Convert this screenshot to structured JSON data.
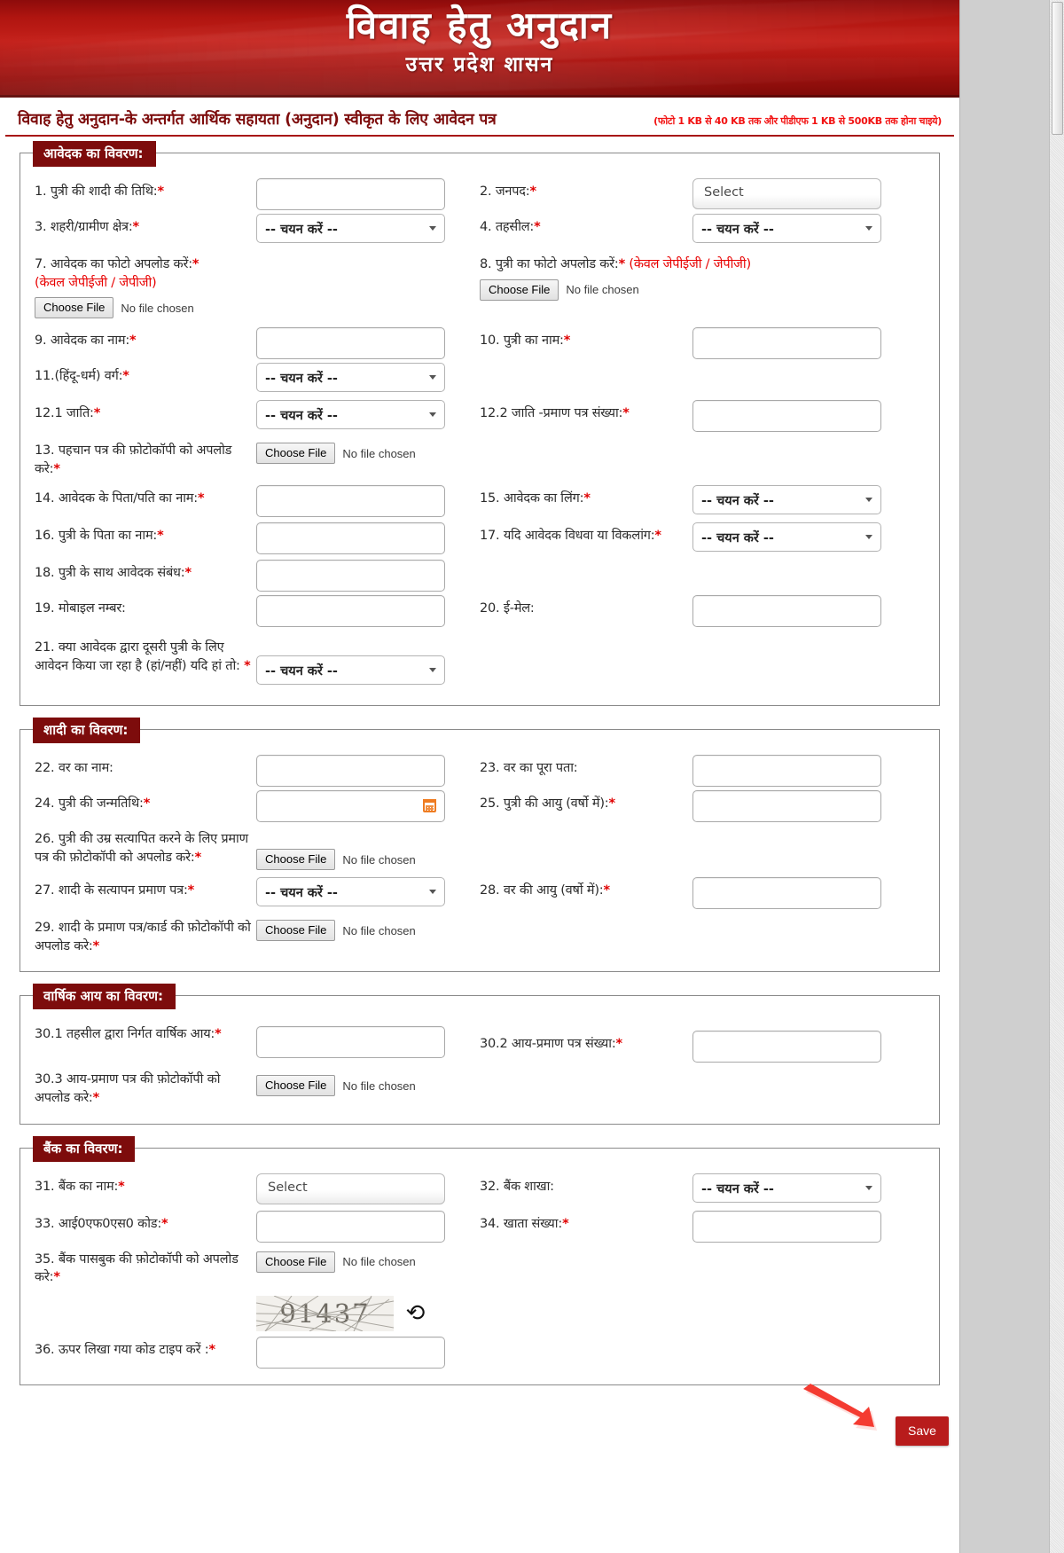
{
  "banner": {
    "title": "विवाह हेतु अनुदान",
    "subtitle": "उत्तर प्रदेश शासन"
  },
  "form": {
    "title": "विवाह हेतु अनुदान-के अन्तर्गत आर्थिक सहायता (अनुदान) स्वीकृत के लिए आवेदन पत्र",
    "note": "(फोटो 1 KB से 40 KB तक और पीडीएफ 1 KB से 500KB तक होना चाइये)"
  },
  "common": {
    "select_placeholder": "-- चयन करें --",
    "select_plain": "Select",
    "choose_file": "Choose File",
    "no_file": "No file chosen"
  },
  "sections": {
    "applicant": {
      "legend": "आवेदक का विवरण:",
      "f1_label": "1. पुत्री की शादी की तिथि:",
      "f2_label": "2. जनपद:",
      "f2_value": "Select",
      "f3_label": "3. शहरी/ग्रामीण क्षेत्र:",
      "f3_value": "-- चयन करें --",
      "f4_label": "4. तहसील:",
      "f4_value": "-- चयन करें --",
      "f7_label": "7. आवेदक का फोटो अपलोड करें:",
      "f7_note": "(केवल जेपीईजी / जेपीजी)",
      "f8_label": "8. पुत्री का फोटो अपलोड करें:",
      "f8_note": "(केवल जेपीईजी / जेपीजी)",
      "f9_label": "9. आवेदक का नाम:",
      "f10_label": "10. पुत्री का नाम:",
      "f11_label": "11.(हिंदू-धर्म) वर्ग:",
      "f11_value": "-- चयन करें --",
      "f121_label": "12.1 जाति:",
      "f121_value": "-- चयन करें --",
      "f122_label": "12.2 जाति -प्रमाण पत्र संख्या:",
      "f13_label": "13. पहचान पत्र की फ़ोटोकॉपी को अपलोड करे:",
      "f14_label": "14. आवेदक के पिता/पति का नाम:",
      "f15_label": "15. आवेदक का लिंग:",
      "f15_value": "-- चयन करें --",
      "f16_label": "16. पुत्री के पिता का नाम:",
      "f17_label": "17. यदि आवेदक विधवा या विकलांग:",
      "f17_value": "-- चयन करें --",
      "f18_label": "18. पुत्री के साथ आवेदक संबंध:",
      "f19_label": "19. मोबाइल नम्बर:",
      "f20_label": "20. ई-मेल:",
      "f21_label": "21. क्या आवेदक द्वारा दूसरी पुत्री के लिए आवेदन किया जा रहा है (हां/नहीं) यदि हां तो:",
      "f21_value": "-- चयन करें --"
    },
    "marriage": {
      "legend": "शादी का विवरण:",
      "f22_label": "22. वर का नाम:",
      "f23_label": "23. वर का पूरा पता:",
      "f24_label": "24. पुत्री की जन्मतिथि:",
      "f25_label": "25. पुत्री की आयु (वर्षो में):",
      "f26_label": "26. पुत्री की उम्र सत्यापित करने के लिए प्रमाण पत्र की फ़ोटोकॉपी को अपलोड करे:",
      "f27_label": "27. शादी के सत्यापन प्रमाण पत्र:",
      "f27_value": "-- चयन करें --",
      "f28_label": "28. वर की आयु (वर्षो में):",
      "f29_label": "29. शादी के प्रमाण पत्र/कार्ड की फ़ोटोकॉपी को अपलोड करे:"
    },
    "income": {
      "legend": "वार्षिक आय का विवरण:",
      "f301_label": "30.1 तहसील द्वारा निर्गत वार्षिक आय:",
      "f302_label": "30.2 आय-प्रमाण पत्र संख्या:",
      "f303_label": "30.3 आय-प्रमाण पत्र की फ़ोटोकॉपी को अपलोड करे:"
    },
    "bank": {
      "legend": "बैंक का विवरण:",
      "f31_label": "31. बैंक का नाम:",
      "f31_value": "Select",
      "f32_label": "32. बैंक शाखा:",
      "f32_value": "-- चयन करें --",
      "f33_label": "33. आई0एफ0एस0 कोड:",
      "f34_label": "34. खाता संख्या:",
      "f35_label": "35. बैंक पासबुक की फ़ोटोकॉपी को अपलोड करे:",
      "captcha_code": "91437",
      "f36_label": "36. ऊपर लिखा गया कोड टाइप करें :",
      "save_label": "Save"
    }
  },
  "colors": {
    "brand_red": "#7d0c0c",
    "accent_red": "#b81c1c",
    "required": "#e00000",
    "arrow": "#f43b31"
  }
}
